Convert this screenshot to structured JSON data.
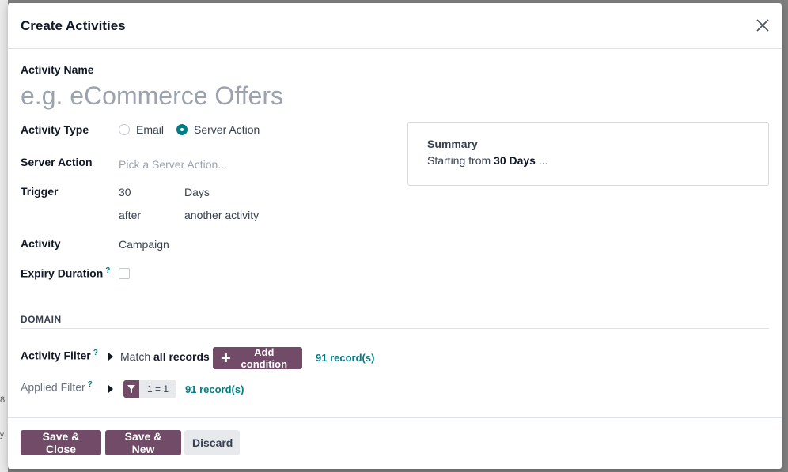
{
  "background": {
    "mark1": "8",
    "mark2": "y"
  },
  "dialog": {
    "title": "Create Activities",
    "close_icon": "close-icon"
  },
  "form": {
    "activity_name": {
      "label": "Activity Name",
      "placeholder": "e.g. eCommerce Offers",
      "value": ""
    },
    "activity_type": {
      "label": "Activity Type",
      "options": [
        {
          "label": "Email",
          "checked": false
        },
        {
          "label": "Server Action",
          "checked": true
        }
      ]
    },
    "server_action": {
      "label": "Server Action",
      "placeholder": "Pick a Server Action..."
    },
    "trigger": {
      "label": "Trigger",
      "interval": "30",
      "unit": "Days",
      "when": "after",
      "reference": "another activity"
    },
    "activity": {
      "label": "Activity",
      "value": "Campaign"
    },
    "expiry": {
      "label": "Expiry Duration",
      "help": "?",
      "checked": false
    }
  },
  "summary": {
    "title": "Summary",
    "prefix": "Starting from",
    "bold": "30 Days",
    "suffix": "..."
  },
  "domain": {
    "section_title": "DOMAIN",
    "activity_filter": {
      "label": "Activity Filter",
      "help": "?",
      "match_prefix": "Match",
      "match_bold": "all records",
      "add_condition_label": "Add condition",
      "add_condition_icon": "plus-icon",
      "records": "91 record(s)"
    },
    "applied_filter": {
      "label": "Applied Filter",
      "help": "?",
      "filter_icon": "filter-icon",
      "expression": "1 = 1",
      "records": "91 record(s)"
    }
  },
  "footer": {
    "save_close": "Save & Close",
    "save_new": "Save & New",
    "discard": "Discard"
  },
  "colors": {
    "primary": "#714b67",
    "accent": "#017e84",
    "muted_bg": "#e7e9ed"
  }
}
